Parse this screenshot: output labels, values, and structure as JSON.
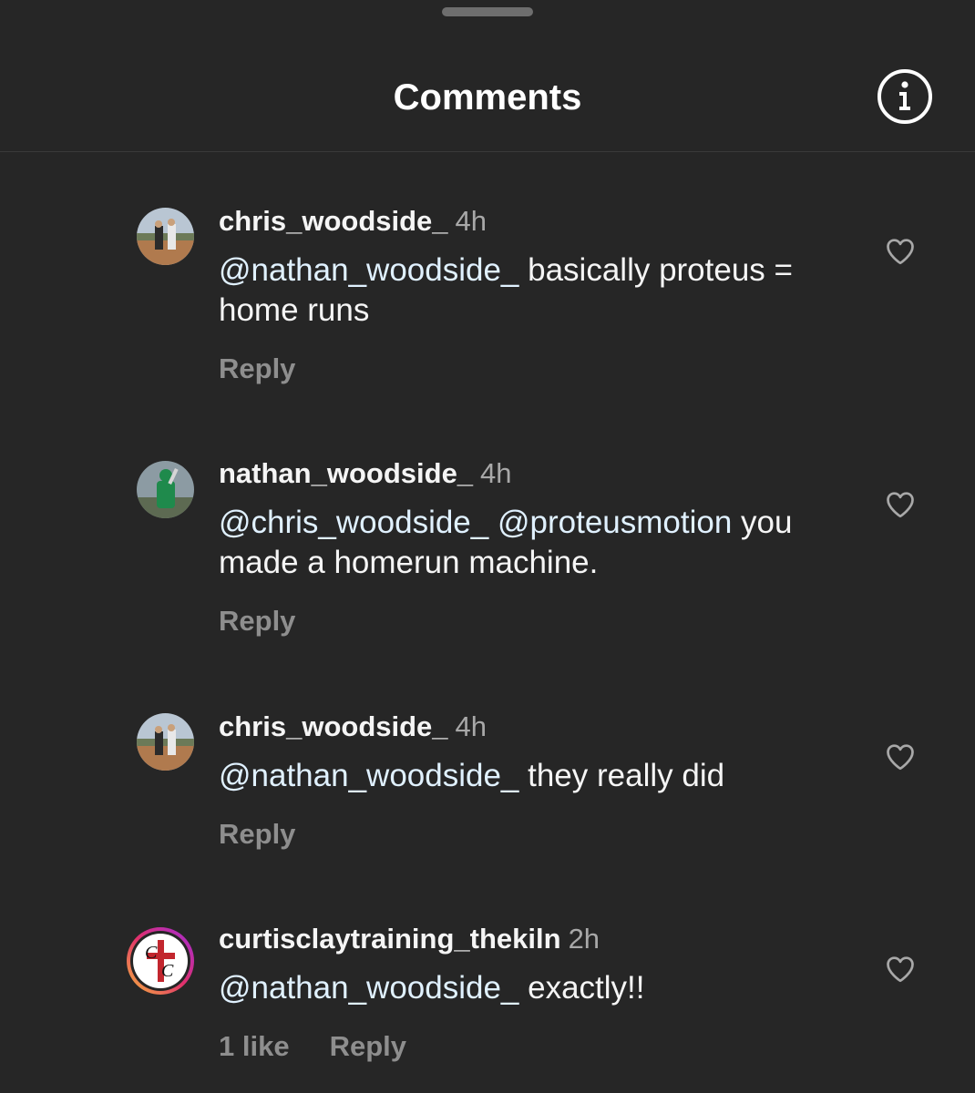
{
  "header": {
    "title": "Comments",
    "info_icon": "info-icon"
  },
  "colors": {
    "background": "#262626",
    "text": "#f5f5f5",
    "secondary_text": "#a8a8a8",
    "mention": "#e0f1ff"
  },
  "comments": [
    {
      "username": "chris_woodside_",
      "time": "4h",
      "mention": "@nathan_woodside_",
      "text": " basically proteus = home runs",
      "reply_label": "Reply",
      "like_icon": "heart-outline-icon"
    },
    {
      "username": "nathan_woodside_",
      "time": "4h",
      "mention": "@chris_woodside_",
      "mention2": "@proteusmotion",
      "text": " you made a homerun machine.",
      "reply_label": "Reply",
      "like_icon": "heart-outline-icon"
    },
    {
      "username": "chris_woodside_",
      "time": "4h",
      "mention": "@nathan_woodside_",
      "text": " they really did",
      "reply_label": "Reply",
      "like_icon": "heart-outline-icon"
    },
    {
      "username": "curtisclaytraining_thekiln",
      "time": "2h",
      "mention": "@nathan_woodside_",
      "text": " exactly!!",
      "likes_label": "1 like",
      "reply_label": "Reply",
      "like_icon": "heart-outline-icon"
    }
  ]
}
